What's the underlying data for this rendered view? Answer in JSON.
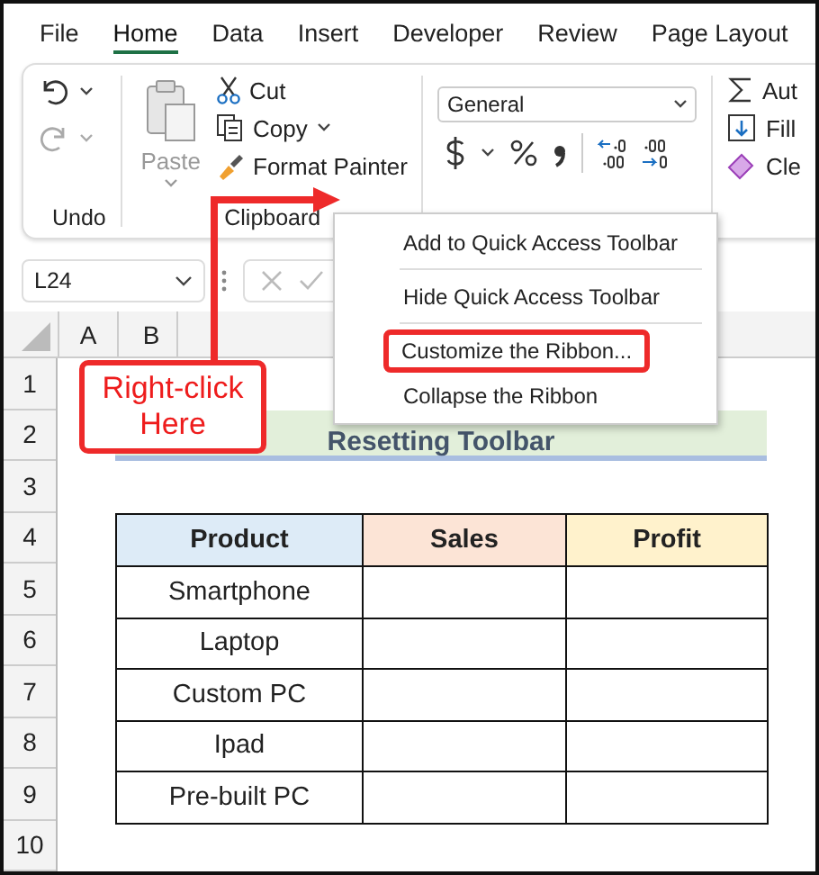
{
  "tabs": [
    {
      "label": "File",
      "selected": false
    },
    {
      "label": "Home",
      "selected": true
    },
    {
      "label": "Data",
      "selected": false
    },
    {
      "label": "Insert",
      "selected": false
    },
    {
      "label": "Developer",
      "selected": false
    },
    {
      "label": "Review",
      "selected": false
    },
    {
      "label": "Page Layout",
      "selected": false
    }
  ],
  "ribbon": {
    "undo": {
      "label": "Undo",
      "undo_disabled": false,
      "redo_disabled": true
    },
    "clipboard": {
      "label": "Clipboard",
      "paste": {
        "label": "Paste",
        "disabled": true
      },
      "cut": "Cut",
      "copy": "Copy",
      "format_painter": "Format Painter"
    },
    "number": {
      "format": "General"
    },
    "editing": {
      "items": [
        {
          "kind": "sum",
          "label": "Aut"
        },
        {
          "kind": "fill",
          "label": "Fill"
        },
        {
          "kind": "clear",
          "label": "Cle"
        }
      ]
    }
  },
  "formula_bar": {
    "name_box": "L24"
  },
  "columns": [
    "A",
    "B"
  ],
  "rows": [
    "1",
    "2",
    "3",
    "4",
    "5",
    "6",
    "7",
    "8",
    "9",
    "10"
  ],
  "sheet_title": "Resetting Toolbar",
  "table": {
    "headers": [
      {
        "label": "Product",
        "color": "#ddebf7"
      },
      {
        "label": "Sales",
        "color": "#fce4d6"
      },
      {
        "label": "Profit",
        "color": "#fff2cc"
      }
    ],
    "rows": [
      "Smartphone",
      "Laptop",
      "Custom PC",
      "Ipad",
      "Pre-built PC"
    ]
  },
  "context_menu": [
    {
      "label": "Add to Quick Access Toolbar",
      "highlighted": false
    },
    {
      "label": "Hide Quick Access Toolbar",
      "highlighted": false
    },
    {
      "label": "Customize the Ribbon...",
      "highlighted": true
    },
    {
      "label": "Collapse the Ribbon",
      "highlighted": false
    }
  ],
  "callout": "Right-click Here"
}
